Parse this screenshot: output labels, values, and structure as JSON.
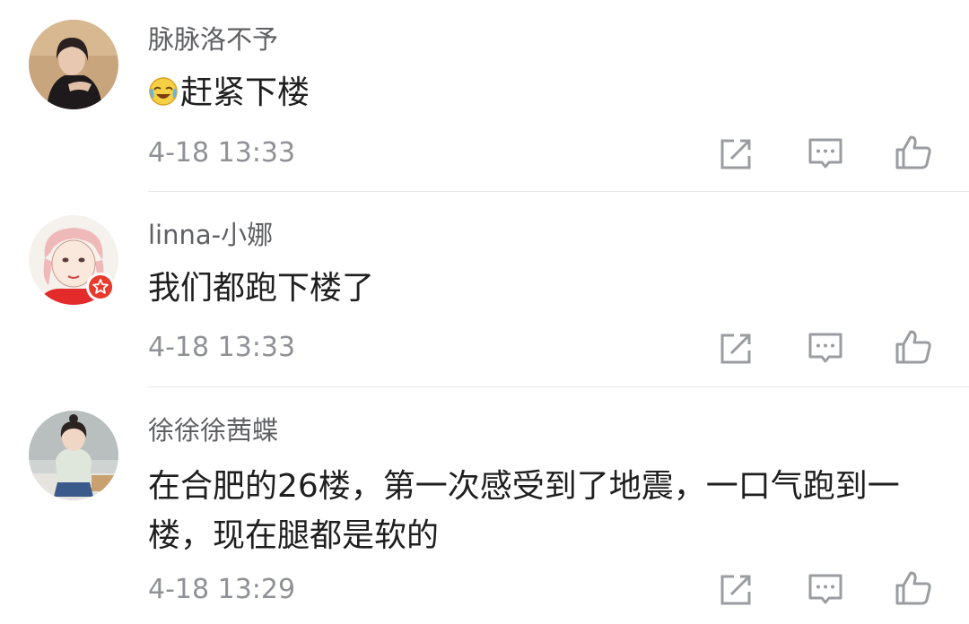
{
  "comments": [
    {
      "username": "脉脉洛不予",
      "emoji": "crying-laughing-emoji",
      "text": "赶紧下楼",
      "time": "4-18 13:33"
    },
    {
      "username": "linna-小娜",
      "text": "我们都跑下楼了",
      "time": "4-18 13:33",
      "badge": "verified-badge"
    },
    {
      "username": "徐徐徐茜蝶",
      "text_line1": "在合肥的26楼，第一次感受到了地震，一口气跑到一",
      "text_line2": "楼，现在腿都是软的",
      "time": "4-18 13:29"
    }
  ],
  "actions": {
    "share_icon": "share-icon",
    "comment_icon": "comment-icon",
    "like_icon": "like-icon"
  },
  "colors": {
    "username": "#5f6063",
    "text": "#1f1f1f",
    "time": "#8f9196",
    "icon": "#9a9ca0",
    "divider": "#e6e6e6",
    "badge": "#e8392c"
  }
}
